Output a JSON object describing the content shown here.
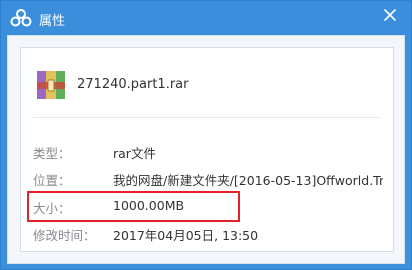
{
  "window": {
    "title": "属性"
  },
  "file": {
    "name": "271240.part1.rar",
    "icon": "winrar-archive-icon"
  },
  "properties": [
    {
      "label": "类型：",
      "value": "rar文件"
    },
    {
      "label": "位置：",
      "value": "我的网盘/新建文件夹/[2016-05-13]Offworld.Tr..."
    },
    {
      "label": "大小：",
      "value": "1000.00MB"
    },
    {
      "label": "修改时间：",
      "value": "2017年04月05日, 13:50"
    }
  ],
  "colors": {
    "titlebar": "#3b8edb",
    "highlight": "#e0242a"
  }
}
